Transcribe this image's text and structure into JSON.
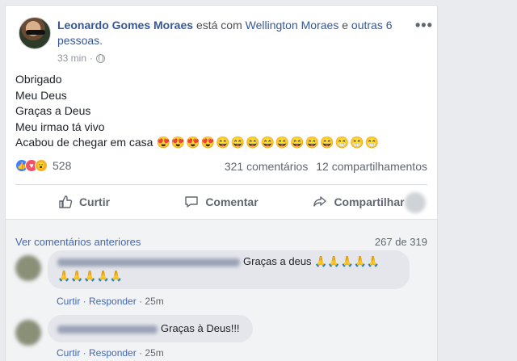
{
  "post": {
    "author": "Leonardo Gomes Moraes",
    "with_text": "está com",
    "tagged": "Wellington Moraes",
    "and_text": "e",
    "others": "outras 6 pessoas.",
    "time": "33 min",
    "lines": [
      "Obrigado",
      "Meu Deus",
      "Graças a Deus",
      "Meu irmao tá vivo",
      "Acabou de chegar em casa"
    ],
    "line5_emojis": "😍😍😍😍😄😄😄😄😄😄😄😄😁😁😁"
  },
  "stats": {
    "reactions": "528",
    "reaction_icons": [
      "like",
      "love",
      "wow"
    ],
    "comments": "321 comentários",
    "shares": "12 compartilhamentos"
  },
  "actions": {
    "like": "Curtir",
    "comment": "Comentar",
    "share": "Compartilhar"
  },
  "comments_section": {
    "view_previous": "Ver comentários anteriores",
    "paging": "267 de 319",
    "items": [
      {
        "text": "Graças a deus",
        "emojis_inline": "🙏🙏🙏🙏🙏",
        "emojis_line2": "🙏🙏🙏🙏🙏",
        "like": "Curtir",
        "reply": "Responder",
        "time": "25m"
      },
      {
        "text": "Graças à Deus!!!",
        "like": "Curtir",
        "reply": "Responder",
        "time": "25m"
      }
    ]
  },
  "colors": {
    "link": "#365899",
    "accent": "#4267b2",
    "muted": "#606770",
    "background": "#e9ebee"
  }
}
